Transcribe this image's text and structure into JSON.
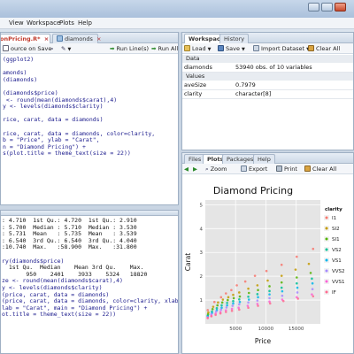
{
  "menu": {
    "items": [
      "View",
      "Workspace",
      "Plots",
      "Help"
    ]
  },
  "editor": {
    "tabs": [
      "onPricing.R*",
      "diamonds"
    ],
    "toolbar": {
      "source_on_save": "ource on Save",
      "run_lines": "Run Line(s)",
      "run_all": "Run All"
    },
    "lines": [
      "(ggplot2)",
      "",
      "amonds)",
      "(diamonds)",
      "",
      "(diamonds$price)",
      " <- round(mean(diamonds$carat),4)",
      "y <- levels(diamonds$clarity)",
      "",
      "rice, carat, data = diamonds)",
      "",
      "rice, carat, data = diamonds, color=clarity,",
      "b = \"Price\", ylab = \"Carat\",",
      "n = \"Diamond Pricing\") +",
      "s(plot.title = theme_text(size = 22))"
    ]
  },
  "console": {
    "lines": [
      ": 4.710  1st Qu.: 4.720  1st Qu.: 2.910",
      ": 5.700  Median : 5.710  Median : 3.530",
      ": 5.731  Mean   : 5.735  Mean   : 3.539",
      ": 6.540  3rd Qu.: 6.540  3rd Qu.: 4.040",
      ":10.740  Max.   :58.900  Max.   :31.800",
      "",
      "ry(diamonds$price)",
      "  1st Qu.  Median    Mean 3rd Qu.    Max.",
      "       950    2401    3933    5324   18820",
      "ze <- round(mean(diamonds$carat),4)",
      "y <- levels(diamonds$clarity)",
      "(price, carat, data = diamonds)",
      "(price, carat, data = diamonds, color=clarity, xlab =",
      "lab = \"Carat\", main = \"Diamond Pricing\") +",
      "ot.title = theme_text(size = 22))"
    ],
    "code_line_indices": [
      6,
      9,
      10,
      11,
      12,
      13,
      14
    ]
  },
  "workspace": {
    "tabs": [
      "Workspace",
      "History"
    ],
    "toolbar": {
      "load": "Load",
      "save": "Save",
      "import": "Import Dataset",
      "clear": "Clear All"
    },
    "data_header": "Data",
    "data_rows": [
      {
        "name": "diamonds",
        "value": "53940 obs. of 10 variables"
      }
    ],
    "values_header": "Values",
    "value_rows": [
      {
        "name": "aveSize",
        "value": "0.7979"
      },
      {
        "name": "clarity",
        "value": "character[8]"
      }
    ]
  },
  "plots": {
    "tabs": [
      "Files",
      "Plots",
      "Packages",
      "Help"
    ],
    "toolbar": {
      "zoom": "Zoom",
      "export": "Export",
      "print": "Print",
      "clear": "Clear All"
    }
  },
  "colors": {
    "accent": "#3a6ea5",
    "plot_bg": "#e5e5e5",
    "clarity": [
      "#f8766d",
      "#c49a00",
      "#53b400",
      "#00c094",
      "#00b6eb",
      "#a58aff",
      "#fb61d7",
      "#ff6c91"
    ]
  },
  "chart_data": {
    "type": "scatter",
    "title": "Diamond Pricing",
    "xlabel": "Price",
    "ylabel": "Carat",
    "x_ticks": [
      5000,
      10000,
      15000
    ],
    "y_ticks": [
      1,
      2,
      3,
      4,
      5
    ],
    "xlim": [
      0,
      19000
    ],
    "ylim": [
      0,
      5.2
    ],
    "legend_title": "clarity",
    "legend_entries": [
      "I1",
      "SI2",
      "SI1",
      "VS2",
      "VS1",
      "VVS2",
      "VVS1",
      "IF"
    ],
    "legend_placement": "right",
    "grid": true,
    "series": [
      {
        "name": "I1",
        "x": [
          400,
          1500,
          2600,
          3400,
          4300,
          5200,
          6600,
          8200,
          10100,
          12600,
          15100,
          17800
        ],
        "y": [
          0.58,
          0.92,
          1.12,
          1.28,
          1.42,
          1.62,
          1.78,
          2.02,
          2.22,
          2.48,
          2.82,
          3.15
        ]
      },
      {
        "name": "SI2",
        "x": [
          500,
          1300,
          2100,
          2900,
          3800,
          4600,
          5600,
          7100,
          8600,
          10300,
          12600,
          14900,
          17100
        ],
        "y": [
          0.48,
          0.72,
          0.9,
          1.02,
          1.12,
          1.22,
          1.32,
          1.48,
          1.62,
          1.82,
          2.02,
          2.28,
          2.52
        ]
      },
      {
        "name": "SI1",
        "x": [
          450,
          1200,
          2000,
          2800,
          3700,
          4700,
          5700,
          7200,
          8700,
          10600,
          12600,
          15100,
          17400
        ],
        "y": [
          0.4,
          0.62,
          0.78,
          0.9,
          1.0,
          1.08,
          1.15,
          1.3,
          1.42,
          1.58,
          1.74,
          1.95,
          2.14
        ]
      },
      {
        "name": "VS2",
        "x": [
          400,
          1100,
          1900,
          2700,
          3600,
          4600,
          5600,
          7100,
          8600,
          10600,
          12600,
          15100,
          17600
        ],
        "y": [
          0.34,
          0.52,
          0.66,
          0.78,
          0.88,
          0.96,
          1.03,
          1.14,
          1.25,
          1.38,
          1.52,
          1.7,
          1.9
        ]
      },
      {
        "name": "VS1",
        "x": [
          400,
          1100,
          1900,
          2700,
          3600,
          4600,
          5700,
          7200,
          8700,
          10600,
          12700,
          15200,
          17700
        ],
        "y": [
          0.31,
          0.46,
          0.58,
          0.68,
          0.78,
          0.86,
          0.92,
          1.02,
          1.12,
          1.24,
          1.37,
          1.52,
          1.7
        ]
      },
      {
        "name": "VVS2",
        "x": [
          400,
          1000,
          1800,
          2600,
          3500,
          4500,
          5600,
          7100,
          8600,
          10600,
          12700,
          15200,
          17700
        ],
        "y": [
          0.28,
          0.4,
          0.52,
          0.6,
          0.69,
          0.76,
          0.82,
          0.9,
          0.98,
          1.08,
          1.18,
          1.32,
          1.46
        ]
      },
      {
        "name": "VVS1",
        "x": [
          400,
          1000,
          1700,
          2500,
          3400,
          4400,
          5500,
          7000,
          8600,
          10600,
          12700,
          15100,
          17600
        ],
        "y": [
          0.25,
          0.34,
          0.43,
          0.5,
          0.57,
          0.63,
          0.68,
          0.76,
          0.84,
          0.94,
          1.02,
          1.12,
          1.24
        ]
      },
      {
        "name": "IF",
        "x": [
          400,
          1000,
          1700,
          2500,
          3400,
          4400,
          5600,
          7100,
          8700,
          10700,
          12900,
          15300,
          17800
        ],
        "y": [
          0.25,
          0.32,
          0.38,
          0.44,
          0.5,
          0.55,
          0.6,
          0.68,
          0.76,
          0.86,
          0.96,
          1.06,
          1.16
        ]
      }
    ]
  }
}
